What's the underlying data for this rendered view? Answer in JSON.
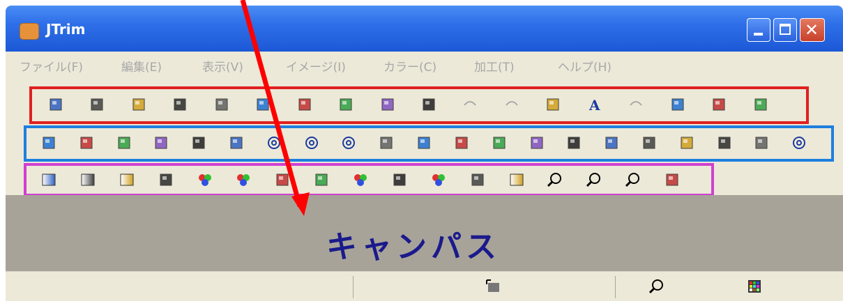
{
  "window": {
    "title": "JTrim",
    "minimize_icon": "minimize-icon",
    "maximize_icon": "maximize-icon",
    "close_icon": "close-icon",
    "close_glyph": "✕"
  },
  "menu": {
    "items": [
      "ファイル(F)",
      "編集(E)",
      "表示(V)",
      "イメージ(I)",
      "カラー(C)",
      "加工(T)",
      "ヘルプ(H)"
    ]
  },
  "annotation": {
    "canvas_label": "キャンパス",
    "arrow_color": "#ff0000"
  },
  "colors": {
    "frame_row1": "#e02020",
    "frame_row2": "#1e7fe0",
    "frame_row3": "#d040d0",
    "titlebar": "#2e6fe8",
    "canvas_bg": "#a8a398",
    "canvas_label": "#1a1a8c"
  },
  "toolbar_rows": [
    [
      "window-icon",
      "new-icon",
      "open-icon",
      "save-icon",
      "print-icon",
      "print-preview-icon",
      "copy-icon",
      "paste-icon",
      "paste-special-icon",
      "fill-icon",
      "undo-icon",
      "redo-icon",
      "fit-window-icon",
      "text-icon",
      "align-icon",
      "thumbnail-icon",
      "filmstrip-icon",
      "palette-icon"
    ],
    [
      "crop-icon",
      "resize-icon",
      "flip-horizontal-icon",
      "flip-vertical-icon",
      "move-icon",
      "frame-icon",
      "rotate-right-90-icon",
      "rotate-left-90-icon",
      "rotate-free-icon",
      "emboss-icon",
      "shadow-icon",
      "starburst-icon",
      "mosaic-icon",
      "wave-icon",
      "tile-icon",
      "grid-icon",
      "glow-icon",
      "ff-effect-icon",
      "draw-pen-icon",
      "eraser-icon",
      "swirl-icon"
    ],
    [
      "gradient-gray-icon",
      "gradient-gold-icon",
      "gradient-blue-icon",
      "brightness-icon",
      "color-balance-icon",
      "hue-icon",
      "image-adjust-icon",
      "gamma-icon",
      "color-wheel-icon",
      "noise-icon",
      "rgb-icon",
      "xor-icon",
      "gray-bar-icon",
      "zoom-icon",
      "zoom-in-icon",
      "zoom-out-icon",
      "eyedropper-icon"
    ]
  ],
  "status": {
    "icons": [
      "resize-icon",
      "zoom-icon",
      "palette-icon"
    ]
  }
}
